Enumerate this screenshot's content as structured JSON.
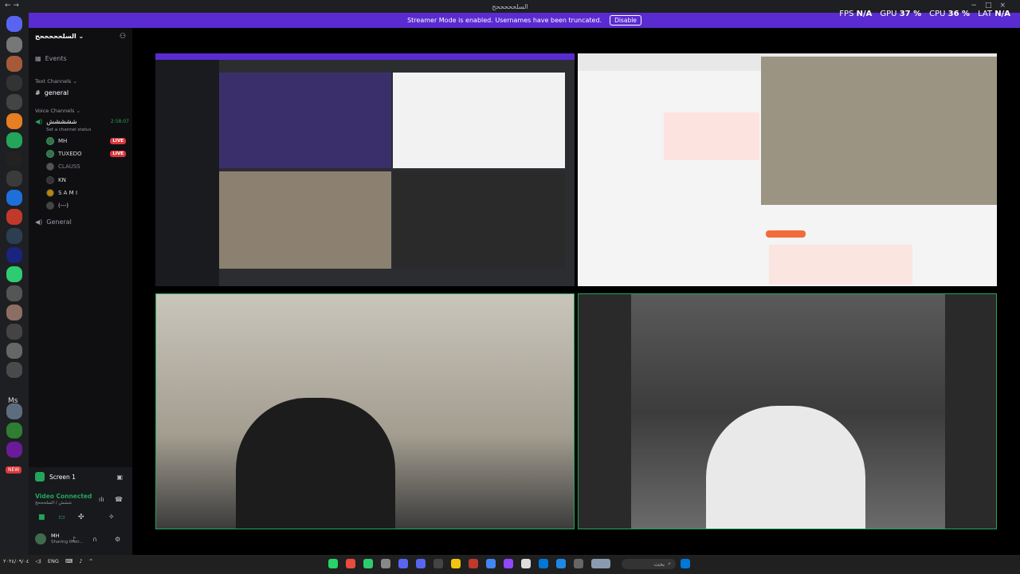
{
  "window": {
    "title": "السلحححححح"
  },
  "banner": {
    "message": "Streamer Mode is enabled. Usernames have been truncated.",
    "disable_label": "Disable"
  },
  "stats": {
    "fps_label": "FPS",
    "fps_value": "N/A",
    "gpu_label": "GPU",
    "gpu_value": "37 %",
    "cpu_label": "CPU",
    "cpu_value": "36 %",
    "lat_label": "LAT",
    "lat_value": "N/A"
  },
  "rail": {
    "ms_label": "Ms",
    "new_badge": "NEW"
  },
  "guild": {
    "name": "السلحححححح"
  },
  "sidebar": {
    "events_label": "Events",
    "text_channels_label": "Text Channels",
    "general_text": "general",
    "voice_channels_label": "Voice Channels",
    "voice_channel_name": "ششششش",
    "voice_channel_status": "Set a channel status",
    "voice_timer": "2:58:07",
    "members": [
      {
        "name": "MH",
        "live": "LIVE"
      },
      {
        "name": "TUXEDO",
        "live": "LIVE"
      },
      {
        "name": "CLAUSS",
        "live": ""
      },
      {
        "name": "KN",
        "live": ""
      },
      {
        "name": "S A M I",
        "live": ""
      },
      {
        "name": "(---)",
        "live": ""
      }
    ],
    "general_voice": "General"
  },
  "panel": {
    "screen_label": "Screen 1",
    "connected_label": "Video Connected",
    "connected_sub": "ششش / السلحححح",
    "user_name": "MH",
    "user_status": "Sharing their..."
  },
  "taskbar": {
    "search_text": "بحث",
    "lang": "ENG",
    "date": "٢٠٢٤/٠٩/٠٤"
  },
  "colors": {
    "accent": "#5a2bd1",
    "speaking": "#23a55a",
    "live": "#da373c"
  }
}
